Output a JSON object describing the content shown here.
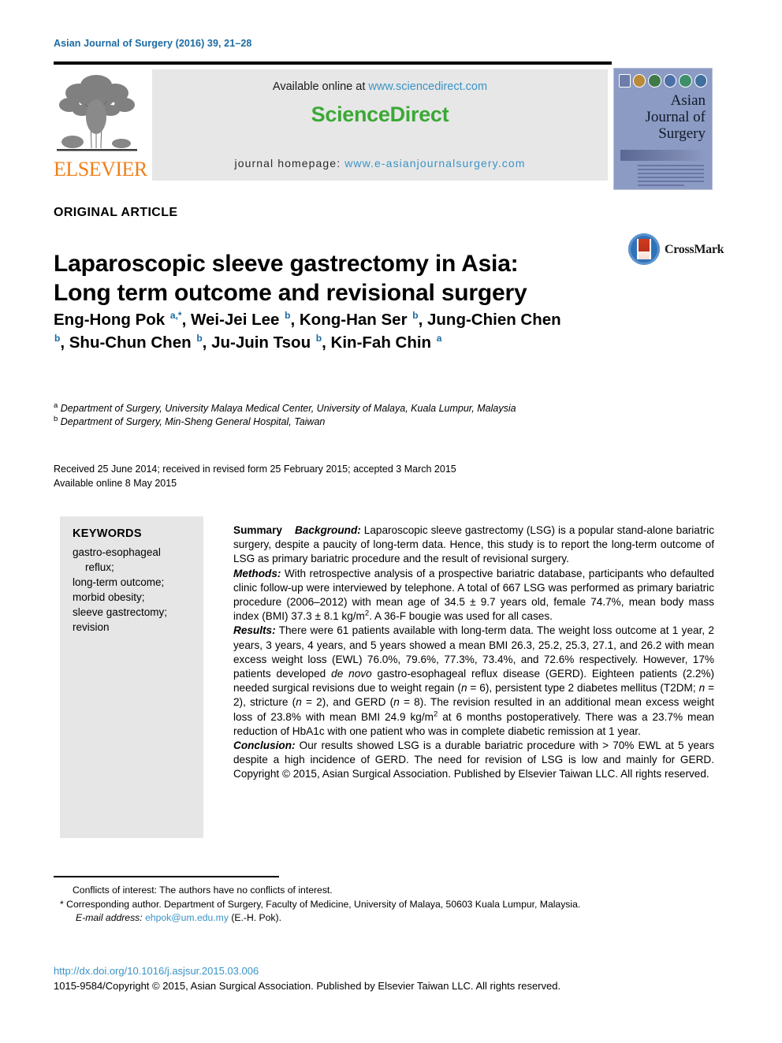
{
  "running_head": "Asian Journal of Surgery (2016) 39, 21–28",
  "header": {
    "elsevier_wordmark": "ELSEVIER",
    "available_online_prefix": "Available online at ",
    "sciencedirect_url": "www.sciencedirect.com",
    "sciencedirect_brand": "ScienceDirect",
    "homepage_prefix": "journal homepage: ",
    "homepage_url": "www.e-asianjournalsurgery.com",
    "cover_title_line1": "Asian",
    "cover_title_line2": "Journal of",
    "cover_title_line3": "Surgery"
  },
  "article": {
    "type": "ORIGINAL ARTICLE",
    "title_line1": "Laparoscopic sleeve gastrectomy in Asia:",
    "title_line2": "Long term outcome and revisional surgery",
    "crossmark_label": "CrossMark"
  },
  "authors": [
    {
      "name": "Eng-Hong Pok",
      "marks": "a,*",
      "sep": ", "
    },
    {
      "name": "Wei-Jei Lee",
      "marks": "b",
      "sep": ", "
    },
    {
      "name": "Kong-Han Ser",
      "marks": "b",
      "sep": ", "
    },
    {
      "name": "Jung-Chien Chen",
      "marks": "b",
      "sep": ", "
    },
    {
      "name": "Shu-Chun Chen",
      "marks": "b",
      "sep": ", "
    },
    {
      "name": "Ju-Juin Tsou",
      "marks": "b",
      "sep": ", "
    },
    {
      "name": "Kin-Fah Chin",
      "marks": "a",
      "sep": ""
    }
  ],
  "affiliations": [
    {
      "mark": "a",
      "text": "Department of Surgery, University Malaya Medical Center, University of Malaya, Kuala Lumpur, Malaysia"
    },
    {
      "mark": "b",
      "text": "Department of Surgery, Min-Sheng General Hospital, Taiwan"
    }
  ],
  "dates": {
    "line1": "Received 25 June 2014; received in revised form 25 February 2015; accepted 3 March 2015",
    "line2": "Available online 8 May 2015"
  },
  "keywords": {
    "title": "KEYWORDS",
    "items": [
      {
        "text": "gastro-esophageal",
        "indent": false
      },
      {
        "text": "reflux;",
        "indent": true
      },
      {
        "text": "long-term outcome;",
        "indent": false
      },
      {
        "text": "morbid obesity;",
        "indent": false
      },
      {
        "text": "sleeve gastrectomy;",
        "indent": false
      },
      {
        "text": "revision",
        "indent": false
      }
    ]
  },
  "abstract": {
    "summary_label": "Summary",
    "background_label": "Background:",
    "background_text": " Laparoscopic sleeve gastrectomy (LSG) is a popular stand-alone bariatric surgery, despite a paucity of long-term data. Hence, this study is to report the long-term outcome of LSG as primary bariatric procedure and the result of revisional surgery.",
    "methods_label": "Methods:",
    "methods_text_a": " With retrospective analysis of a prospective bariatric database, participants who defaulted clinic follow-up were interviewed by telephone. A total of 667 LSG was performed as primary bariatric procedure (2006–2012) with mean age of 34.5 ± 9.7 years old, female 74.7%, mean body mass index (BMI) 37.3 ± 8.1 kg/m",
    "methods_sup": "2",
    "methods_text_b": ". A 36-F bougie was used for all cases.",
    "results_label": "Results:",
    "results_text_a": " There were 61 patients available with long-term data. The weight loss outcome at 1 year, 2 years, 3 years, 4 years, and 5 years showed a mean BMI 26.3, 25.2, 25.3, 27.1, and 26.2 with mean excess weight loss (EWL) 76.0%, 79.6%, 77.3%, 73.4%, and 72.6% respectively. However, 17% patients developed ",
    "results_italic1": "de novo",
    "results_text_b": " gastro-esophageal reflux disease (GERD). Eighteen patients (2.2%) needed surgical revisions due to weight regain (",
    "results_italic2": "n",
    "results_text_c": " = 6), persistent type 2 diabetes mellitus (T2DM; ",
    "results_italic3": "n",
    "results_text_d": " = 2), stricture (",
    "results_italic4": "n",
    "results_text_e": " = 2), and GERD (",
    "results_italic5": "n",
    "results_text_f": " = 8). The revision resulted in an additional mean excess weight loss of 23.8% with mean BMI 24.9 kg/m",
    "results_sup": "2",
    "results_text_g": " at 6 months postoperatively. There was a 23.7% mean reduction of HbA1c with one patient who was in complete diabetic remission at 1 year.",
    "conclusion_label": "Conclusion:",
    "conclusion_text": " Our results showed LSG is a durable bariatric procedure with > 70% EWL at 5 years despite a high incidence of GERD. The need for revision of LSG is low and mainly for GERD.",
    "copyright_text": "Copyright © 2015, Asian Surgical Association. Published by Elsevier Taiwan LLC. All rights reserved."
  },
  "footnotes": {
    "conflicts": "Conflicts of interest: The authors have no conflicts of interest.",
    "corresponding_mark": "*",
    "corresponding": " Corresponding author. Department of Surgery, Faculty of Medicine, University of Malaya, 50603 Kuala Lumpur, Malaysia.",
    "email_label": "E-mail address:",
    "email": "ehpok@um.edu.my",
    "email_suffix": " (E.-H. Pok)."
  },
  "bottom": {
    "doi": "http://dx.doi.org/10.1016/j.asjsur.2015.03.006",
    "copyright": "1015-9584/Copyright © 2015, Asian Surgical Association. Published by Elsevier Taiwan LLC. All rights reserved."
  },
  "colors": {
    "running_head": "#1a6aa2",
    "link": "#3a93c6",
    "sciencedirect_green": "#3aa935",
    "elsevier_orange": "#F07F1A",
    "panel_gray": "#e6e6e6"
  }
}
